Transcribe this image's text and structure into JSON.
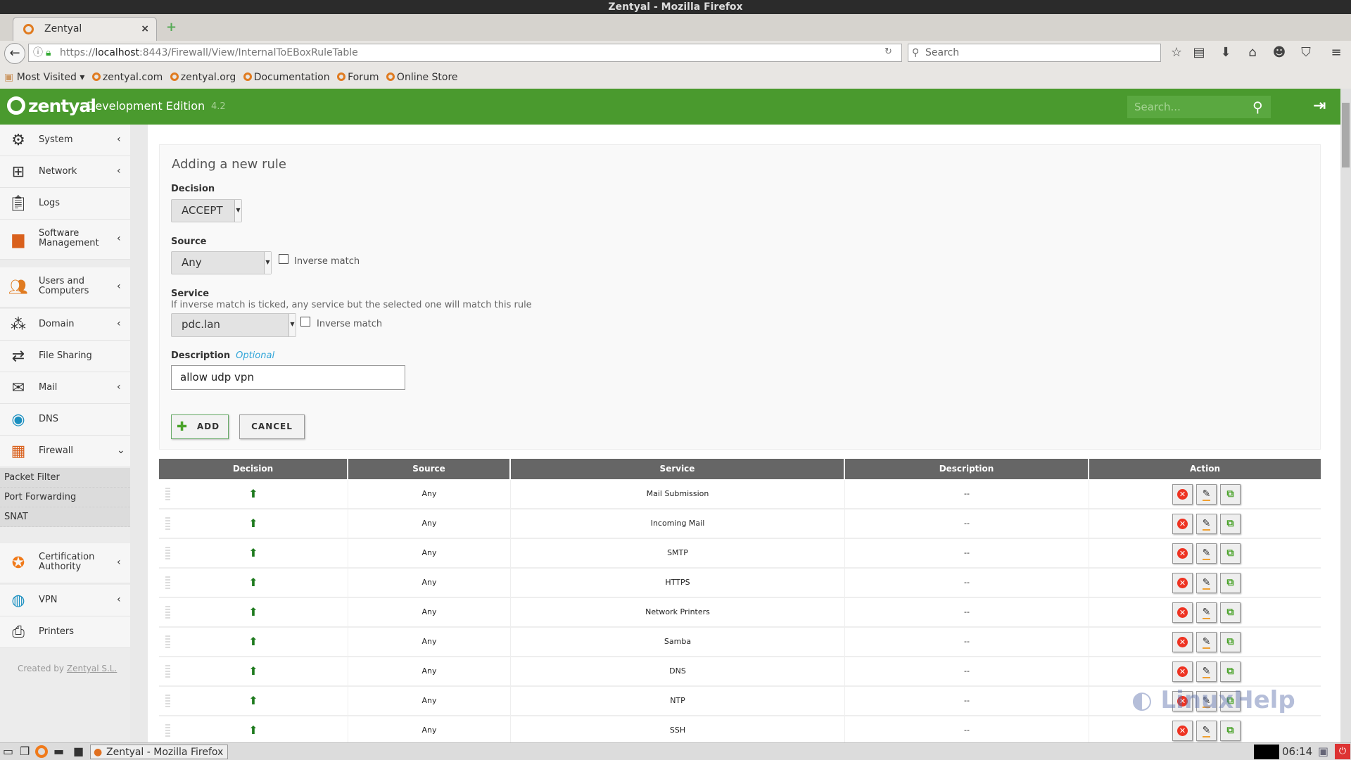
{
  "window": {
    "title": "Zentyal - Mozilla Firefox"
  },
  "browser": {
    "tab_label": "Zentyal",
    "url_prefix": "https://",
    "url_host": "localhost",
    "url_rest": ":8443/Firewall/View/InternalToEBoxRuleTable",
    "search_placeholder": "Search",
    "bookmarks": [
      "Most Visited",
      "zentyal.com",
      "zentyal.org",
      "Documentation",
      "Forum",
      "Online Store"
    ]
  },
  "header": {
    "brand": "zentyal",
    "edition": "Development Edition",
    "version": "4.2",
    "search_placeholder": "Search..."
  },
  "sidebar": {
    "items": [
      {
        "label": "System",
        "icon": "gear-icon",
        "chev": "‹"
      },
      {
        "label": "Network",
        "icon": "network-icon",
        "chev": "‹"
      },
      {
        "label": "Logs",
        "icon": "clipboard-icon",
        "chev": ""
      },
      {
        "label": "Software Management",
        "icon": "box-icon",
        "chev": "‹"
      },
      {
        "label": "Users and Computers",
        "icon": "users-icon",
        "chev": "‹"
      },
      {
        "label": "Domain",
        "icon": "domain-icon",
        "chev": "‹"
      },
      {
        "label": "File Sharing",
        "icon": "file-sharing-icon",
        "chev": ""
      },
      {
        "label": "Mail",
        "icon": "mail-icon",
        "chev": "‹"
      },
      {
        "label": "DNS",
        "icon": "dns-icon",
        "chev": ""
      },
      {
        "label": "Firewall",
        "icon": "firewall-icon",
        "chev": "⌄"
      },
      {
        "label": "Certification Authority",
        "icon": "certificate-icon",
        "chev": "‹"
      },
      {
        "label": "VPN",
        "icon": "vpn-icon",
        "chev": "‹"
      },
      {
        "label": "Printers",
        "icon": "printer-icon",
        "chev": ""
      }
    ],
    "firewall_sub": [
      "Packet Filter",
      "Port Forwarding",
      "SNAT"
    ],
    "credit_prefix": "Created by",
    "credit_link": "Zentyal S.L."
  },
  "form": {
    "title": "Adding a new rule",
    "decision_label": "Decision",
    "decision_value": "ACCEPT",
    "source_label": "Source",
    "source_value": "Any",
    "source_inverse": "Inverse match",
    "service_label": "Service",
    "service_help": "If inverse match is ticked, any service but the selected one will match this rule",
    "service_value": "pdc.lan",
    "service_inverse": "Inverse match",
    "description_label": "Description",
    "description_optional": "Optional",
    "description_value": "allow udp vpn",
    "add_label": "ADD",
    "cancel_label": "CANCEL"
  },
  "table": {
    "headers": [
      "Decision",
      "Source",
      "Service",
      "Description",
      "Action"
    ],
    "rows": [
      {
        "source": "Any",
        "service": "Mail Submission",
        "description": "--"
      },
      {
        "source": "Any",
        "service": "Incoming Mail",
        "description": "--"
      },
      {
        "source": "Any",
        "service": "SMTP",
        "description": "--"
      },
      {
        "source": "Any",
        "service": "HTTPS",
        "description": "--"
      },
      {
        "source": "Any",
        "service": "Network Printers",
        "description": "--"
      },
      {
        "source": "Any",
        "service": "Samba",
        "description": "--"
      },
      {
        "source": "Any",
        "service": "DNS",
        "description": "--"
      },
      {
        "source": "Any",
        "service": "NTP",
        "description": "--"
      },
      {
        "source": "Any",
        "service": "SSH",
        "description": "--"
      }
    ]
  },
  "taskbar": {
    "task": "Zentyal - Mozilla Firefox",
    "clock": "06:14"
  },
  "watermark": "LinuxHelp",
  "colors": {
    "brand_green": "#4a9a2e",
    "table_header": "#666666",
    "accept_arrow": "#1e7a1e",
    "delete_red": "#ee3322"
  }
}
